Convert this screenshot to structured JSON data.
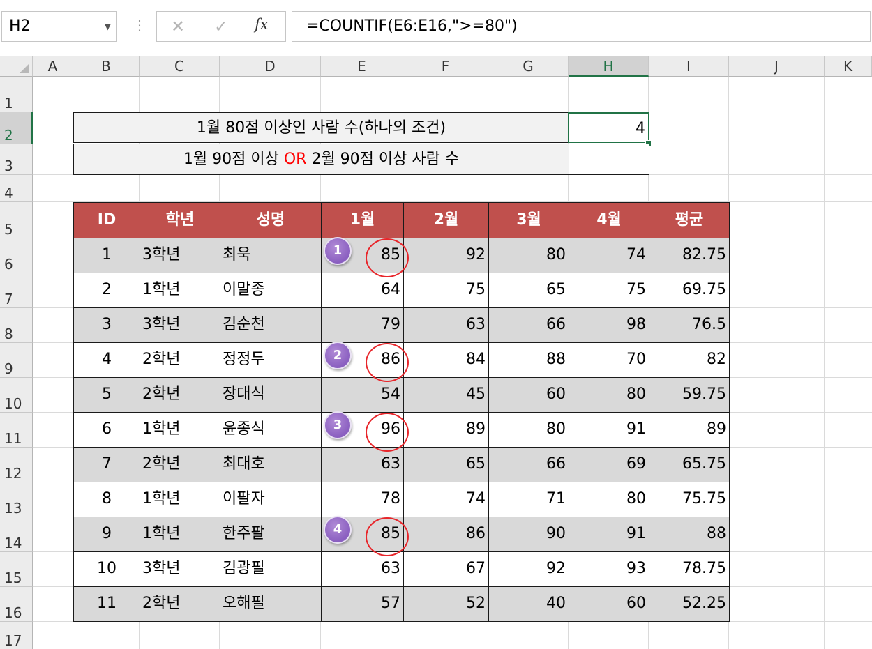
{
  "formula_bar": {
    "name_box": "H2",
    "cancel_icon": "✕",
    "enter_icon": "✓",
    "fx_icon": "fx",
    "formula": "=COUNTIF(E6:E16,\">=80\")"
  },
  "columns": [
    "A",
    "B",
    "C",
    "D",
    "E",
    "F",
    "G",
    "H",
    "I",
    "J",
    "K"
  ],
  "rows": [
    "1",
    "2",
    "3",
    "4",
    "5",
    "6",
    "7",
    "8",
    "9",
    "10",
    "11",
    "12",
    "13",
    "14",
    "15",
    "16",
    "17"
  ],
  "selected_cell": {
    "column": "H",
    "row": "2"
  },
  "summary": {
    "row2_label": "1월 80점 이상인 사람 수(하나의 조건)",
    "row2_value": "4",
    "row3_label_a": "1월 90점 이상 ",
    "row3_label_or": "OR",
    "row3_label_b": " 2월 90점 이상 사람 수",
    "row3_value": ""
  },
  "table": {
    "headers": [
      "ID",
      "학년",
      "성명",
      "1월",
      "2월",
      "3월",
      "4월",
      "평균"
    ],
    "rows": [
      [
        "1",
        "3학년",
        "최욱",
        "85",
        "92",
        "80",
        "74",
        "82.75"
      ],
      [
        "2",
        "1학년",
        "이말종",
        "64",
        "75",
        "65",
        "75",
        "69.75"
      ],
      [
        "3",
        "3학년",
        "김순천",
        "79",
        "63",
        "66",
        "98",
        "76.5"
      ],
      [
        "4",
        "2학년",
        "정정두",
        "86",
        "84",
        "88",
        "70",
        "82"
      ],
      [
        "5",
        "2학년",
        "장대식",
        "54",
        "45",
        "60",
        "80",
        "59.75"
      ],
      [
        "6",
        "1학년",
        "윤종식",
        "96",
        "89",
        "80",
        "91",
        "89"
      ],
      [
        "7",
        "2학년",
        "최대호",
        "63",
        "65",
        "66",
        "69",
        "65.75"
      ],
      [
        "8",
        "1학년",
        "이팔자",
        "78",
        "74",
        "71",
        "80",
        "75.75"
      ],
      [
        "9",
        "1학년",
        "한주팔",
        "85",
        "86",
        "90",
        "91",
        "88"
      ],
      [
        "10",
        "3학년",
        "김광필",
        "63",
        "67",
        "92",
        "93",
        "78.75"
      ],
      [
        "11",
        "2학년",
        "오해필",
        "57",
        "52",
        "40",
        "60",
        "52.25"
      ]
    ]
  },
  "annotations": {
    "badges": [
      "1",
      "2",
      "3",
      "4"
    ],
    "highlighted_rows": [
      1,
      4,
      6,
      9
    ],
    "colors": {
      "badge": "#8a5fc0",
      "ring": "#e8262b",
      "header": "#c0504d",
      "or_text": "#ff0000"
    }
  }
}
